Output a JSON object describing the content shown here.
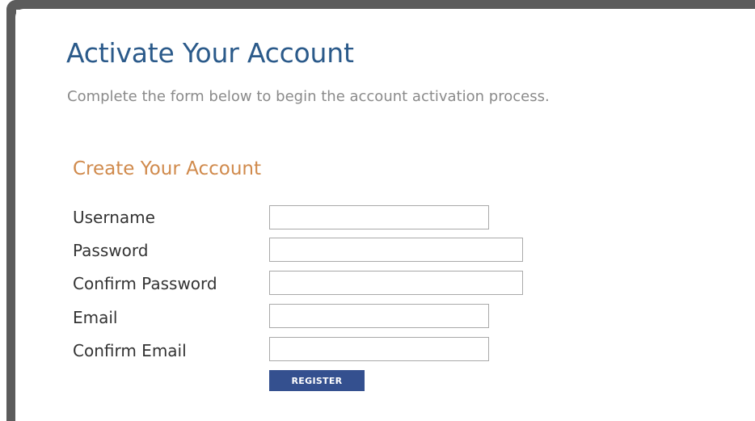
{
  "header": {
    "title": "Activate Your Account",
    "subtitle": "Complete the form below to begin the account activation process."
  },
  "form": {
    "section_title": "Create Your Account",
    "fields": [
      {
        "label": "Username",
        "value": ""
      },
      {
        "label": "Password",
        "value": ""
      },
      {
        "label": "Confirm Password",
        "value": ""
      },
      {
        "label": "Email",
        "value": ""
      },
      {
        "label": "Confirm Email",
        "value": ""
      }
    ],
    "submit_label": "REGISTER"
  },
  "colors": {
    "title": "#2b5a8a",
    "section_title": "#d08a4c",
    "button": "#34508f",
    "frame": "#5c5c5c"
  }
}
